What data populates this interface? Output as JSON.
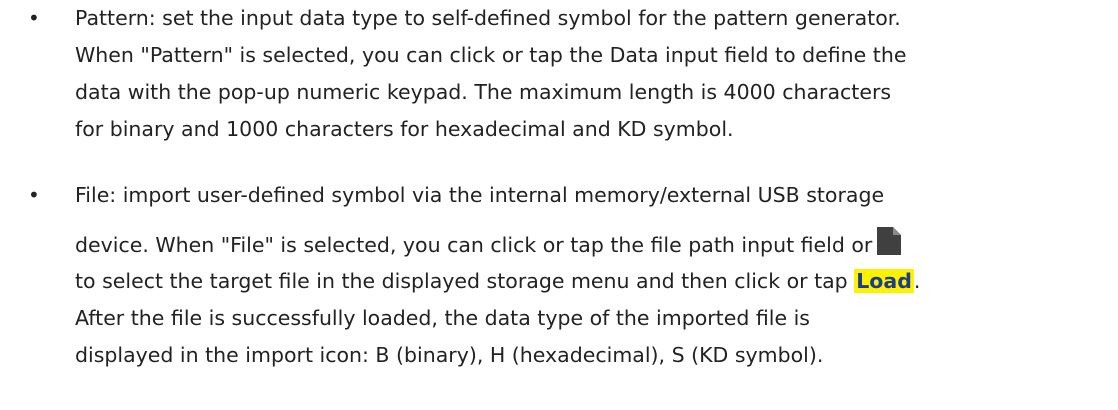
{
  "bullets": {
    "symbol": "•"
  },
  "pattern_item": {
    "line1": "Pattern: set the input data type to self-defined symbol for the pattern generator.",
    "line2": "When \"Pattern\" is selected, you can click or tap the Data input field to define the",
    "line3": "data with the pop-up numeric keypad. The maximum length is 4000 characters",
    "line4": "for binary and 1000 characters for hexadecimal and KD symbol."
  },
  "file_item": {
    "line1": "File: import user-defined symbol via the internal memory/external USB storage",
    "line2": "device. When \"File\" is selected, you can click or tap the file path input field or",
    "line3_pre": "to select the target file in the displayed storage menu and then click or tap ",
    "load_label": "Load",
    "line3_post": ".",
    "line4": "After the file is successfully loaded, the data type of the imported file is",
    "line5": "displayed in the import icon: B (binary), H (hexadecimal), S (KD symbol).",
    "file_icon": "file-icon",
    "icon_color": "#404040",
    "load_highlight": "#fff200",
    "load_text_color": "#1a3d8f"
  }
}
